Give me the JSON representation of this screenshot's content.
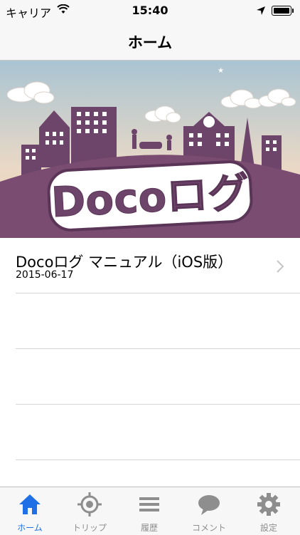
{
  "status_bar": {
    "carrier": "キャリア",
    "time": "15:40"
  },
  "nav": {
    "title": "ホーム"
  },
  "banner": {
    "logo_text": "Docoログ"
  },
  "list": [
    {
      "title": "Docoログ マニュアル（iOS版）",
      "date": "2015-06-17"
    }
  ],
  "tabs": [
    {
      "label": "ホーム",
      "icon": "home-icon",
      "active": true
    },
    {
      "label": "トリップ",
      "icon": "target-icon",
      "active": false
    },
    {
      "label": "履歴",
      "icon": "list-icon",
      "active": false
    },
    {
      "label": "コメント",
      "icon": "comment-icon",
      "active": false
    },
    {
      "label": "設定",
      "icon": "gear-icon",
      "active": false
    }
  ],
  "colors": {
    "accent": "#1f6fe6",
    "banner_ground": "#7a4c72",
    "banner_sky_top": "#a9c4d2",
    "banner_sky_bottom": "#f3d6b6"
  }
}
